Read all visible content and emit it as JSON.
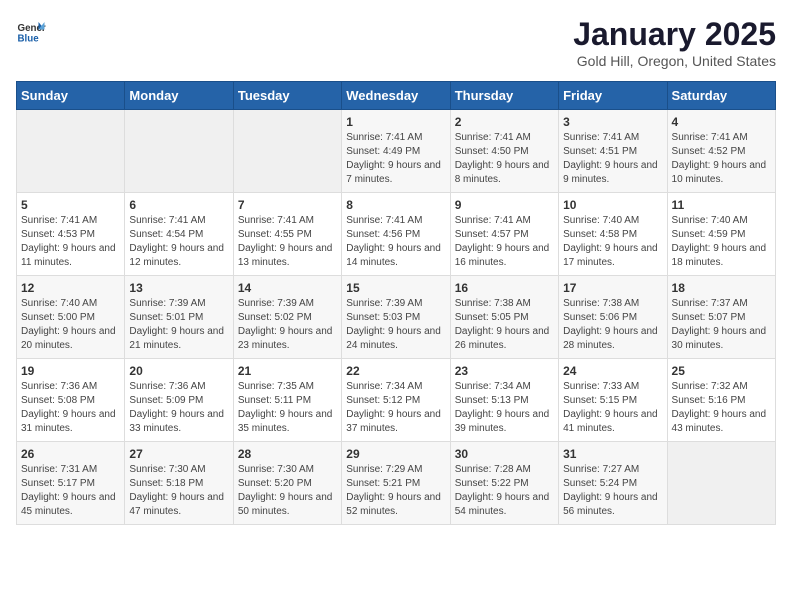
{
  "logo": {
    "text_general": "General",
    "text_blue": "Blue"
  },
  "title": "January 2025",
  "subtitle": "Gold Hill, Oregon, United States",
  "days_of_week": [
    "Sunday",
    "Monday",
    "Tuesday",
    "Wednesday",
    "Thursday",
    "Friday",
    "Saturday"
  ],
  "weeks": [
    [
      {
        "day": "",
        "info": ""
      },
      {
        "day": "",
        "info": ""
      },
      {
        "day": "",
        "info": ""
      },
      {
        "day": "1",
        "info": "Sunrise: 7:41 AM\nSunset: 4:49 PM\nDaylight: 9 hours and 7 minutes."
      },
      {
        "day": "2",
        "info": "Sunrise: 7:41 AM\nSunset: 4:50 PM\nDaylight: 9 hours and 8 minutes."
      },
      {
        "day": "3",
        "info": "Sunrise: 7:41 AM\nSunset: 4:51 PM\nDaylight: 9 hours and 9 minutes."
      },
      {
        "day": "4",
        "info": "Sunrise: 7:41 AM\nSunset: 4:52 PM\nDaylight: 9 hours and 10 minutes."
      }
    ],
    [
      {
        "day": "5",
        "info": "Sunrise: 7:41 AM\nSunset: 4:53 PM\nDaylight: 9 hours and 11 minutes."
      },
      {
        "day": "6",
        "info": "Sunrise: 7:41 AM\nSunset: 4:54 PM\nDaylight: 9 hours and 12 minutes."
      },
      {
        "day": "7",
        "info": "Sunrise: 7:41 AM\nSunset: 4:55 PM\nDaylight: 9 hours and 13 minutes."
      },
      {
        "day": "8",
        "info": "Sunrise: 7:41 AM\nSunset: 4:56 PM\nDaylight: 9 hours and 14 minutes."
      },
      {
        "day": "9",
        "info": "Sunrise: 7:41 AM\nSunset: 4:57 PM\nDaylight: 9 hours and 16 minutes."
      },
      {
        "day": "10",
        "info": "Sunrise: 7:40 AM\nSunset: 4:58 PM\nDaylight: 9 hours and 17 minutes."
      },
      {
        "day": "11",
        "info": "Sunrise: 7:40 AM\nSunset: 4:59 PM\nDaylight: 9 hours and 18 minutes."
      }
    ],
    [
      {
        "day": "12",
        "info": "Sunrise: 7:40 AM\nSunset: 5:00 PM\nDaylight: 9 hours and 20 minutes."
      },
      {
        "day": "13",
        "info": "Sunrise: 7:39 AM\nSunset: 5:01 PM\nDaylight: 9 hours and 21 minutes."
      },
      {
        "day": "14",
        "info": "Sunrise: 7:39 AM\nSunset: 5:02 PM\nDaylight: 9 hours and 23 minutes."
      },
      {
        "day": "15",
        "info": "Sunrise: 7:39 AM\nSunset: 5:03 PM\nDaylight: 9 hours and 24 minutes."
      },
      {
        "day": "16",
        "info": "Sunrise: 7:38 AM\nSunset: 5:05 PM\nDaylight: 9 hours and 26 minutes."
      },
      {
        "day": "17",
        "info": "Sunrise: 7:38 AM\nSunset: 5:06 PM\nDaylight: 9 hours and 28 minutes."
      },
      {
        "day": "18",
        "info": "Sunrise: 7:37 AM\nSunset: 5:07 PM\nDaylight: 9 hours and 30 minutes."
      }
    ],
    [
      {
        "day": "19",
        "info": "Sunrise: 7:36 AM\nSunset: 5:08 PM\nDaylight: 9 hours and 31 minutes."
      },
      {
        "day": "20",
        "info": "Sunrise: 7:36 AM\nSunset: 5:09 PM\nDaylight: 9 hours and 33 minutes."
      },
      {
        "day": "21",
        "info": "Sunrise: 7:35 AM\nSunset: 5:11 PM\nDaylight: 9 hours and 35 minutes."
      },
      {
        "day": "22",
        "info": "Sunrise: 7:34 AM\nSunset: 5:12 PM\nDaylight: 9 hours and 37 minutes."
      },
      {
        "day": "23",
        "info": "Sunrise: 7:34 AM\nSunset: 5:13 PM\nDaylight: 9 hours and 39 minutes."
      },
      {
        "day": "24",
        "info": "Sunrise: 7:33 AM\nSunset: 5:15 PM\nDaylight: 9 hours and 41 minutes."
      },
      {
        "day": "25",
        "info": "Sunrise: 7:32 AM\nSunset: 5:16 PM\nDaylight: 9 hours and 43 minutes."
      }
    ],
    [
      {
        "day": "26",
        "info": "Sunrise: 7:31 AM\nSunset: 5:17 PM\nDaylight: 9 hours and 45 minutes."
      },
      {
        "day": "27",
        "info": "Sunrise: 7:30 AM\nSunset: 5:18 PM\nDaylight: 9 hours and 47 minutes."
      },
      {
        "day": "28",
        "info": "Sunrise: 7:30 AM\nSunset: 5:20 PM\nDaylight: 9 hours and 50 minutes."
      },
      {
        "day": "29",
        "info": "Sunrise: 7:29 AM\nSunset: 5:21 PM\nDaylight: 9 hours and 52 minutes."
      },
      {
        "day": "30",
        "info": "Sunrise: 7:28 AM\nSunset: 5:22 PM\nDaylight: 9 hours and 54 minutes."
      },
      {
        "day": "31",
        "info": "Sunrise: 7:27 AM\nSunset: 5:24 PM\nDaylight: 9 hours and 56 minutes."
      },
      {
        "day": "",
        "info": ""
      }
    ]
  ]
}
